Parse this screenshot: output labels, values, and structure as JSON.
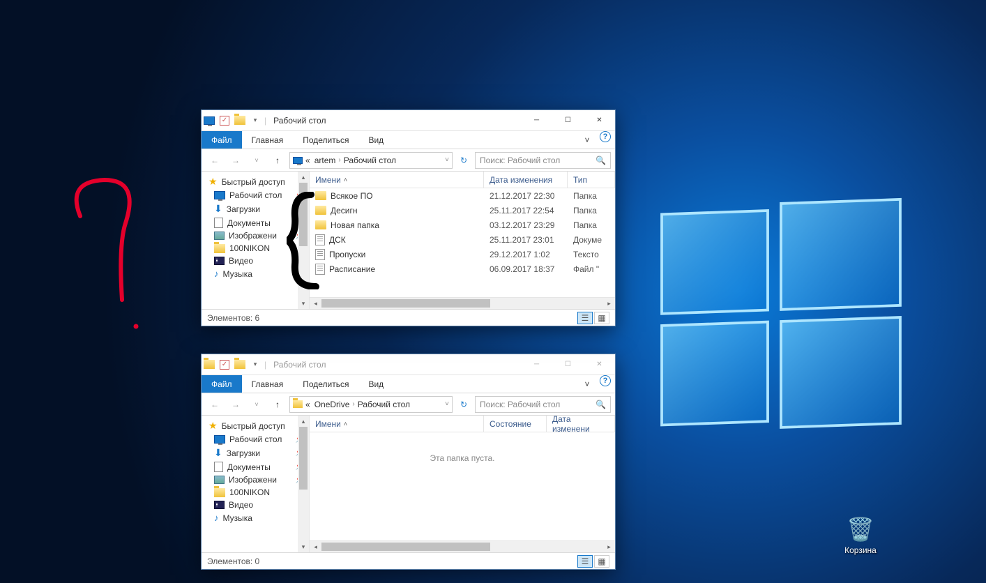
{
  "desktop": {
    "recycle_bin": "Корзина"
  },
  "win1": {
    "title": "Рабочий стол",
    "ribbon": {
      "file": "Файл",
      "home": "Главная",
      "share": "Поделиться",
      "view": "Вид"
    },
    "breadcrumb": {
      "pre": "«",
      "seg1": "artem",
      "seg2": "Рабочий стол"
    },
    "search_placeholder": "Поиск: Рабочий стол",
    "columns": {
      "name": "Имени",
      "date": "Дата изменения",
      "type": "Тип"
    },
    "sidebar": {
      "quick": "Быстрый доступ",
      "desktop": "Рабочий стол",
      "downloads": "Загрузки",
      "documents": "Документы",
      "pictures": "Изображени",
      "n100": "100NIKON",
      "video": "Видео",
      "music": "Музыка"
    },
    "files": [
      {
        "name": "Всякое ПО",
        "date": "21.12.2017 22:30",
        "type": "Папка",
        "kind": "folder"
      },
      {
        "name": "Десигн",
        "date": "25.11.2017 22:54",
        "type": "Папка",
        "kind": "folder"
      },
      {
        "name": "Новая папка",
        "date": "03.12.2017 23:29",
        "type": "Папка",
        "kind": "folder"
      },
      {
        "name": "ДСК",
        "date": "25.11.2017 23:01",
        "type": "Докуме",
        "kind": "file"
      },
      {
        "name": "Пропуски",
        "date": "29.12.2017 1:02",
        "type": "Тексто",
        "kind": "file"
      },
      {
        "name": "Расписание",
        "date": "06.09.2017 18:37",
        "type": "Файл \"",
        "kind": "file"
      }
    ],
    "status": "Элементов: 6"
  },
  "win2": {
    "title": "Рабочий стол",
    "ribbon": {
      "file": "Файл",
      "home": "Главная",
      "share": "Поделиться",
      "view": "Вид"
    },
    "breadcrumb": {
      "pre": "«",
      "seg1": "OneDrive",
      "seg2": "Рабочий стол"
    },
    "search_placeholder": "Поиск: Рабочий стол",
    "columns": {
      "name": "Имени",
      "state": "Состояние",
      "date": "Дата изменени"
    },
    "sidebar": {
      "quick": "Быстрый доступ",
      "desktop": "Рабочий стол",
      "downloads": "Загрузки",
      "documents": "Документы",
      "pictures": "Изображени",
      "n100": "100NIKON",
      "video": "Видео",
      "music": "Музыка"
    },
    "empty": "Эта папка пуста.",
    "status": "Элементов: 0"
  }
}
